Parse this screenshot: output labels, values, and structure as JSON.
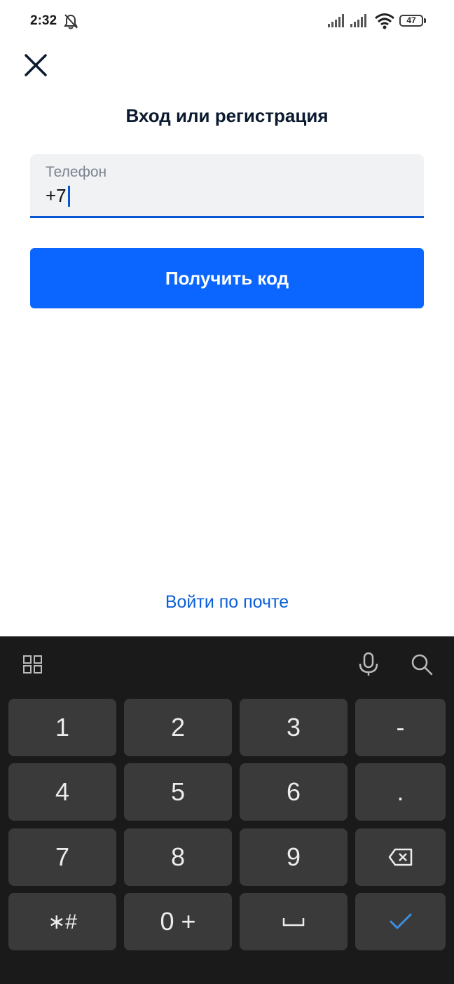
{
  "status_bar": {
    "time": "2:32",
    "battery": "47"
  },
  "title": "Вход или регистрация",
  "phone_field": {
    "label": "Телефон",
    "value": "+7"
  },
  "get_code_button": "Получить код",
  "email_link": "Войти по почте",
  "keyboard": {
    "keys": {
      "k1": "1",
      "k2": "2",
      "k3": "3",
      "dash": "-",
      "k4": "4",
      "k5": "5",
      "k6": "6",
      "dot": ".",
      "k7": "7",
      "k8": "8",
      "k9": "9",
      "star_hash": "∗#",
      "zero_plus": "0 +"
    },
    "icons": [
      "grid-icon",
      "mic-icon",
      "search-icon",
      "backspace-icon",
      "space-icon",
      "check-icon"
    ]
  },
  "colors": {
    "accent": "#0a66ff",
    "link": "#0a5fd8",
    "keyboard_bg": "#1a1a1a",
    "key_bg": "#3a3a3a",
    "check": "#3d8fe0"
  }
}
